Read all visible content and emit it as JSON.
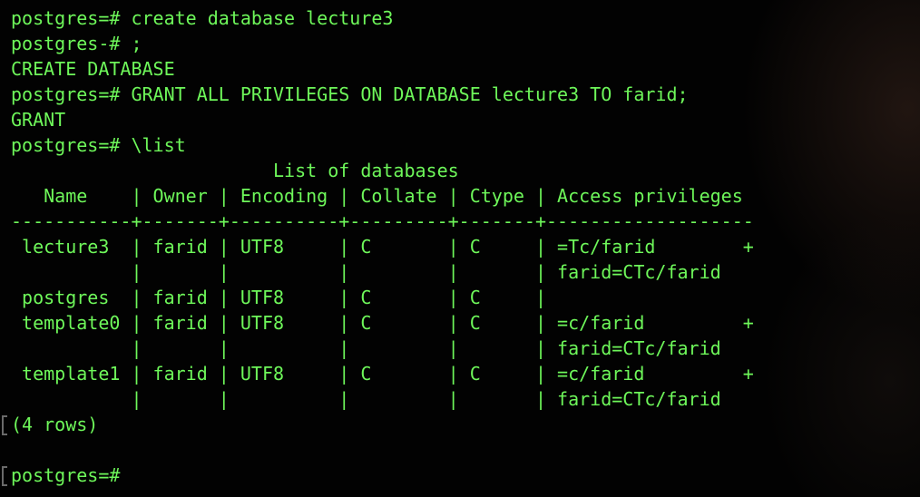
{
  "terminal": {
    "lines": [
      "postgres=# create database lecture3",
      "postgres-# ;",
      "CREATE DATABASE",
      "postgres=# GRANT ALL PRIVILEGES ON DATABASE lecture3 TO farid;",
      "GRANT",
      "postgres=# \\list",
      "                        List of databases",
      "   Name    | Owner | Encoding | Collate | Ctype | Access privileges",
      "-----------+-------+----------+---------+-------+-------------------",
      " lecture3  | farid | UTF8     | C       | C     | =Tc/farid        +",
      "           |       |          |         |       | farid=CTc/farid",
      " postgres  | farid | UTF8     | C       | C     |",
      " template0 | farid | UTF8     | C       | C     | =c/farid         +",
      "           |       |          |         |       | farid=CTc/farid",
      " template1 | farid | UTF8     | C       | C     | =c/farid         +",
      "           |       |          |         |       | farid=CTc/farid",
      "(4 rows)",
      "",
      "postgres=#"
    ]
  },
  "colors": {
    "text": "#6ef75a",
    "background": "#020202"
  }
}
